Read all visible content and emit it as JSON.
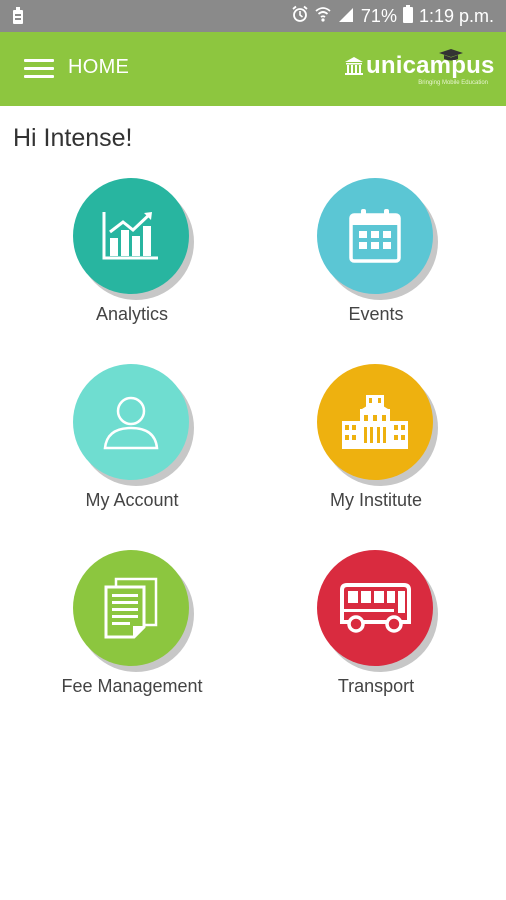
{
  "status_bar": {
    "battery_percent": "71%",
    "time": "1:19 p.m."
  },
  "app_bar": {
    "title": "HOME",
    "logo_text": "unicampus",
    "logo_tagline": "Bringing Mobile Education"
  },
  "greeting": "Hi  Intense!",
  "tiles": [
    {
      "label": "Analytics",
      "color": "#28b5a0",
      "icon": "analytics-chart-icon"
    },
    {
      "label": "Events",
      "color": "#5bc6d4",
      "icon": "calendar-icon"
    },
    {
      "label": "My Account",
      "color": "#6fddd0",
      "icon": "user-icon"
    },
    {
      "label": "My Institute",
      "color": "#eeb10f",
      "icon": "institute-building-icon"
    },
    {
      "label": "Fee Management",
      "color": "#8cc63f",
      "icon": "documents-icon"
    },
    {
      "label": "Transport",
      "color": "#d92b3f",
      "icon": "bus-icon"
    }
  ],
  "colors": {
    "app_bar": "#8dc63f",
    "status_bar": "#8a8a8a"
  }
}
